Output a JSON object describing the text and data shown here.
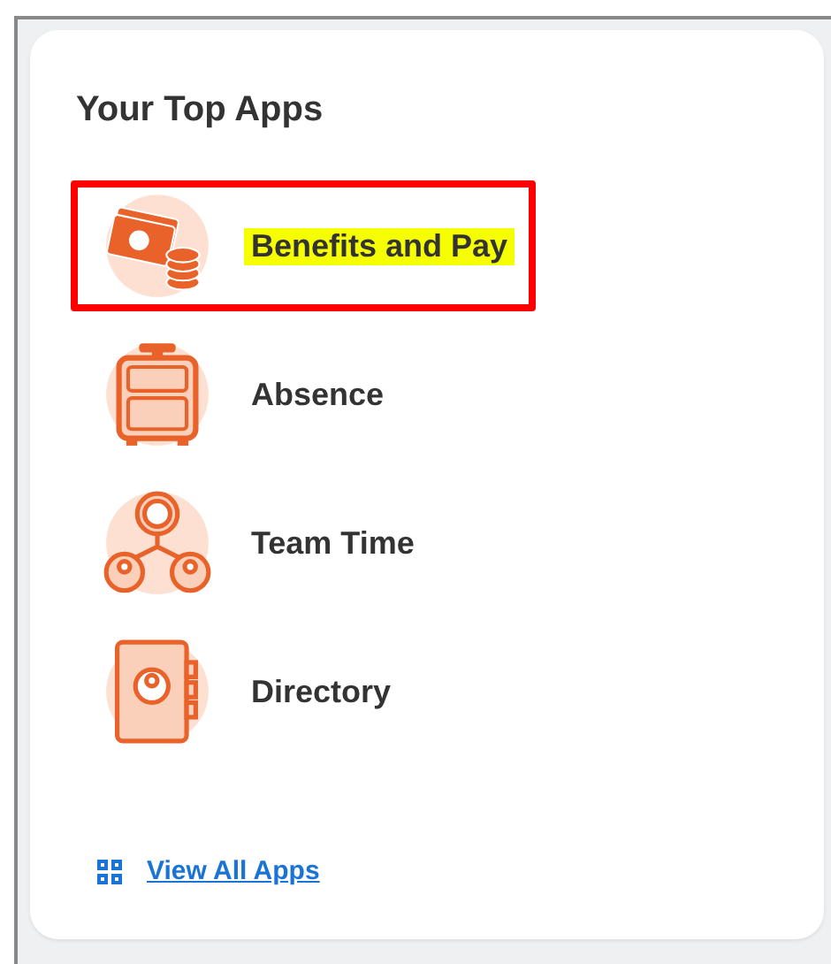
{
  "card": {
    "title": "Your Top Apps",
    "apps": [
      {
        "label": "Benefits and Pay",
        "kind": "money",
        "highlighted": true,
        "outlined": true
      },
      {
        "label": "Absence",
        "kind": "luggage",
        "highlighted": false,
        "outlined": false
      },
      {
        "label": "Team Time",
        "kind": "team",
        "highlighted": false,
        "outlined": false
      },
      {
        "label": "Directory",
        "kind": "book",
        "highlighted": false,
        "outlined": false
      }
    ],
    "link": {
      "label": "View All Apps"
    }
  }
}
